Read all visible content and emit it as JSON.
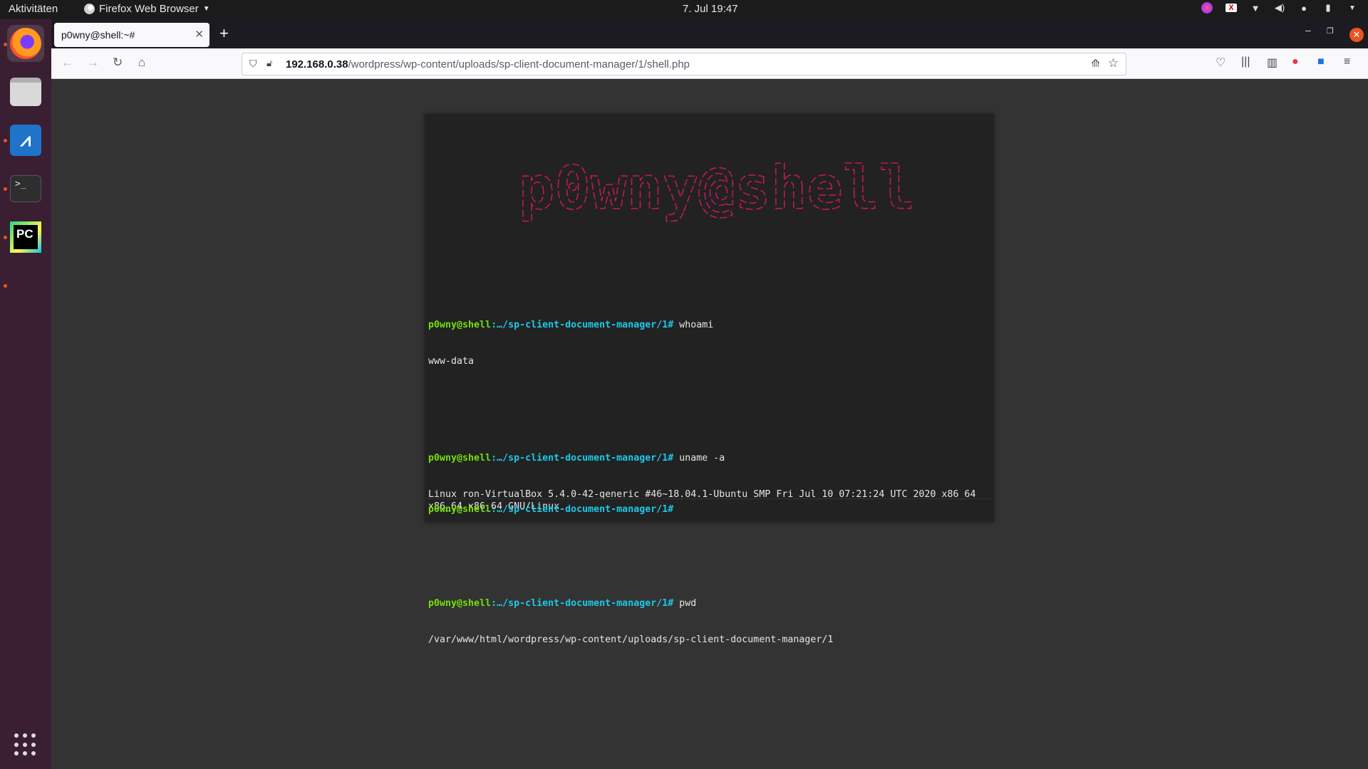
{
  "topbar": {
    "activities": "Aktivitäten",
    "app_name": "Firefox Web Browser",
    "clock": "7. Jul  19:47",
    "tray_icons": [
      "app-indicator-icon",
      "app-indicator-x-icon",
      "wifi-icon",
      "volume-icon",
      "microphone-icon",
      "battery-icon",
      "power-menu-icon"
    ]
  },
  "dock": {
    "items": [
      "firefox",
      "files",
      "system-monitor",
      "terminal",
      "pycharm"
    ],
    "show_apps_icon": "grid-icon"
  },
  "browser": {
    "tab_title": "p0wny@shell:~#",
    "new_tab": "+",
    "url_host": "192.168.0.38",
    "url_path": "/wordpress/wp-content/uploads/sp-client-document-manager/1/shell.php"
  },
  "shell": {
    "banner_text": "p0wny@shell",
    "banner_color": "#c2185b",
    "commands": [
      {
        "user": "p0wny@shell",
        "path": ":…/sp-client-document-manager/1#",
        "command": " whoami",
        "output": "www-data"
      },
      {
        "user": "p0wny@shell",
        "path": ":…/sp-client-document-manager/1#",
        "command": " uname -a",
        "output": "Linux ron-VirtualBox 5.4.0-42-generic #46~18.04.1-Ubuntu SMP Fri Jul 10 07:21:24 UTC 2020 x86_64\nx86_64 x86_64 GNU/Linux"
      },
      {
        "user": "p0wny@shell",
        "path": ":…/sp-client-document-manager/1#",
        "command": " pwd",
        "output": "/var/www/html/wordpress/wp-content/uploads/sp-client-document-manager/1"
      }
    ],
    "input_prompt_user": "p0wny@shell",
    "input_prompt_path": ":…/sp-client-document-manager/1#"
  },
  "colors": {
    "prompt_user": "#75df0b",
    "prompt_path": "#1bc9e7",
    "dock_bg": "#3a1f33",
    "accent": "#e95420"
  }
}
